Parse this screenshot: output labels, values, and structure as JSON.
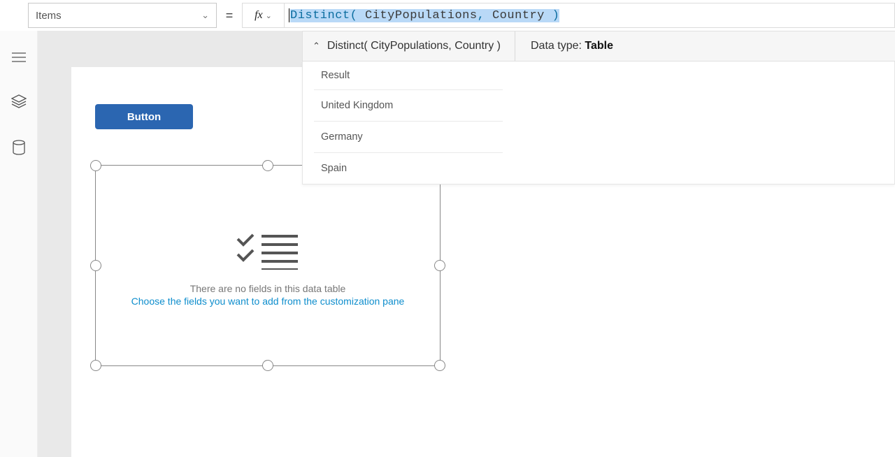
{
  "topbar": {
    "property": "Items",
    "equals": "=",
    "fx": "fx",
    "formula_tokens": {
      "t1": "Distinct(",
      "t2": " CityPopulations",
      "t3": ",",
      "t4": " Country ",
      "t5": ")"
    }
  },
  "resultbar": {
    "expression": "Distinct( CityPopulations, Country )",
    "datatype_label": "Data type: ",
    "datatype_value": "Table"
  },
  "result_panel": {
    "header": "Result",
    "rows": [
      "United Kingdom",
      "Germany",
      "Spain"
    ]
  },
  "canvas": {
    "button_label": "Button",
    "empty_msg1": "There are no fields in this data table",
    "empty_msg2": "Choose the fields you want to add from the customization pane"
  }
}
